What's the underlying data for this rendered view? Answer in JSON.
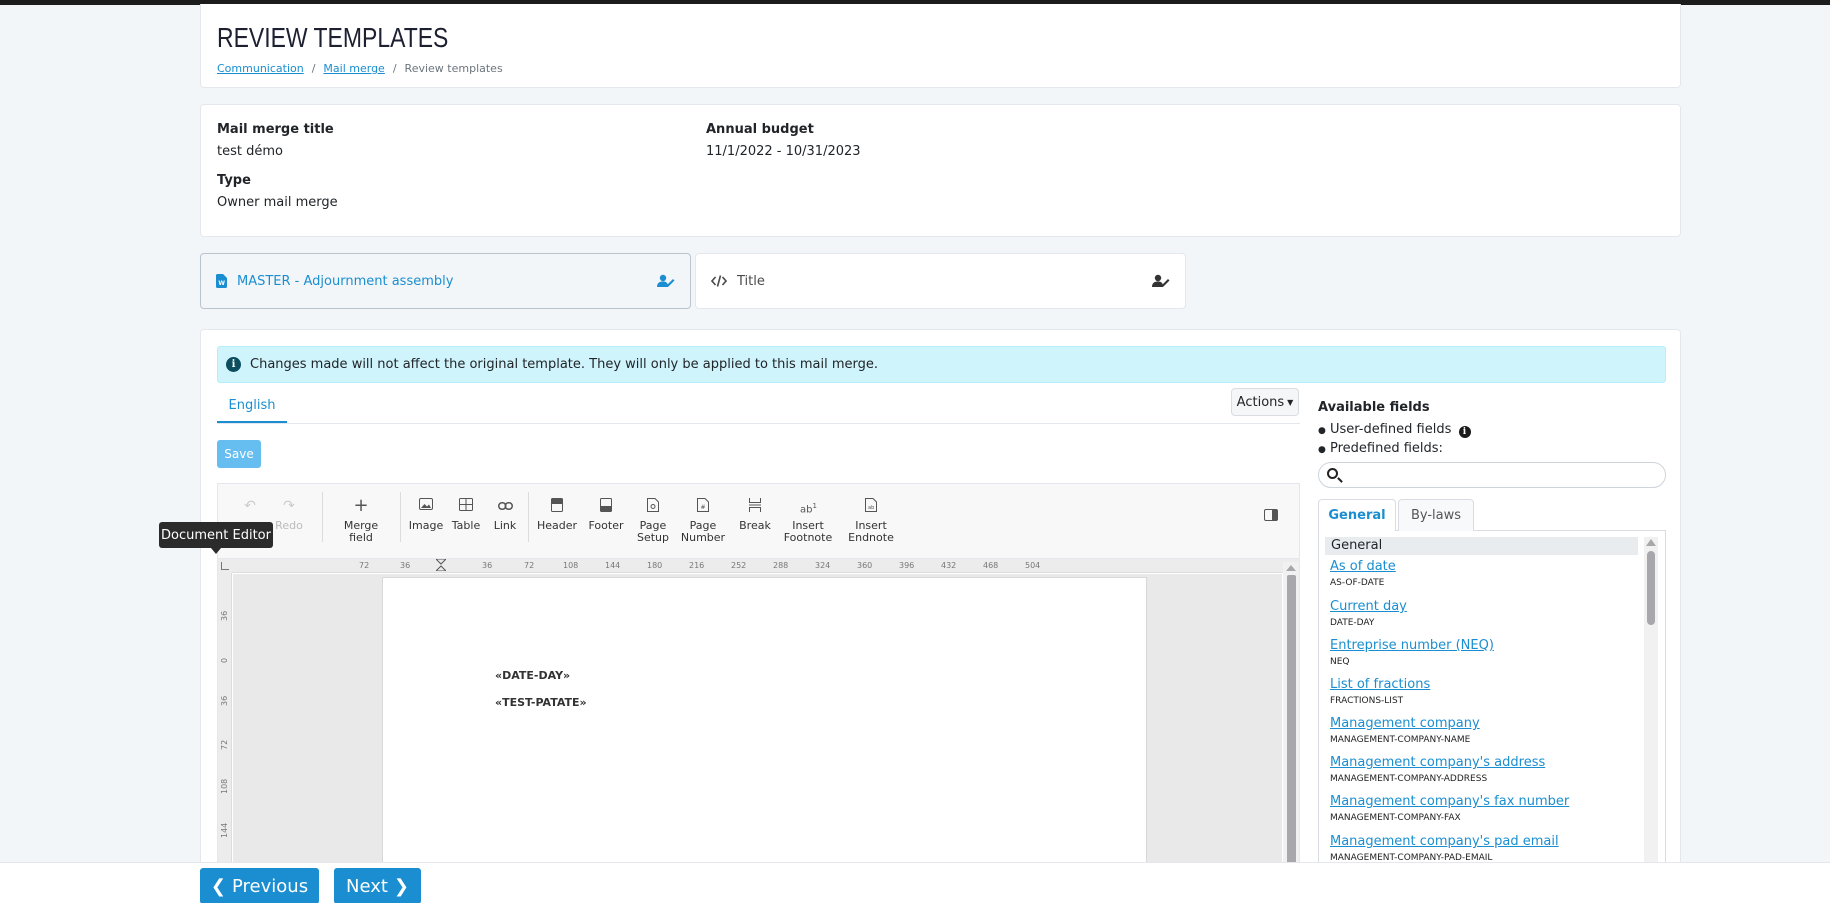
{
  "page": {
    "title": "REVIEW TEMPLATES",
    "breadcrumb": [
      "Communication",
      "Mail merge",
      "Review templates"
    ],
    "breadcrumb_sep": "/"
  },
  "info": {
    "mail_merge_title_label": "Mail merge title",
    "mail_merge_title_value": "test démo",
    "type_label": "Type",
    "type_value": "Owner mail merge",
    "annual_budget_label": "Annual budget",
    "annual_budget_value": "11/1/2022 - 10/31/2023"
  },
  "template_tabs": [
    {
      "label": "MASTER - Adjournment assembly",
      "icon": "word-doc-icon",
      "active": true
    },
    {
      "label": "Title",
      "icon": "code-icon",
      "active": false
    }
  ],
  "editor": {
    "alert_text": "Changes made will not affect the original template. They will only be applied to this mail merge.",
    "language_tab": "English",
    "actions_label": "Actions",
    "save_label": "Save",
    "tooltip": "Document Editor",
    "toolbar": {
      "undo": "Undo",
      "redo": "Redo",
      "merge_field": "Merge field",
      "image": "Image",
      "table": "Table",
      "link": "Link",
      "header": "Header",
      "footer": "Footer",
      "page_setup_1": "Page",
      "page_setup_2": "Setup",
      "page_number_1": "Page",
      "page_number_2": "Number",
      "break": "Break",
      "insert_footnote_1": "Insert",
      "insert_footnote_2": "Footnote",
      "insert_endnote_1": "Insert",
      "insert_endnote_2": "Endnote"
    },
    "ruler_h": [
      "72",
      "36",
      "36",
      "72",
      "108",
      "144",
      "180",
      "216",
      "252",
      "288",
      "324",
      "360",
      "396",
      "432",
      "468",
      "504"
    ],
    "ruler_v": [
      "36",
      "0",
      "36",
      "72",
      "108",
      "144"
    ],
    "merge_fields": [
      "«DATE-DAY»",
      "«TEST-PATATE»"
    ]
  },
  "fields_panel": {
    "title": "Available fields",
    "user_defined": "User-defined fields",
    "predefined": "Predefined fields:",
    "bullet": "●",
    "search_placeholder": "",
    "tabs": [
      "General",
      "By-laws"
    ],
    "group": "General",
    "items": [
      {
        "label": "As of date",
        "code": "AS-OF-DATE"
      },
      {
        "label": "Current day",
        "code": "DATE-DAY"
      },
      {
        "label": "Entreprise number (NEQ)",
        "code": "NEQ"
      },
      {
        "label": "List of fractions",
        "code": "FRACTIONS-LIST"
      },
      {
        "label": "Management company",
        "code": "MANAGEMENT-COMPANY-NAME"
      },
      {
        "label": "Management company's address",
        "code": "MANAGEMENT-COMPANY-ADDRESS"
      },
      {
        "label": "Management company's fax number",
        "code": "MANAGEMENT-COMPANY-FAX"
      },
      {
        "label": "Management company's pad email",
        "code": "MANAGEMENT-COMPANY-PAD-EMAIL"
      }
    ]
  },
  "footer": {
    "previous_label": "Previous",
    "next_label": "Next"
  }
}
